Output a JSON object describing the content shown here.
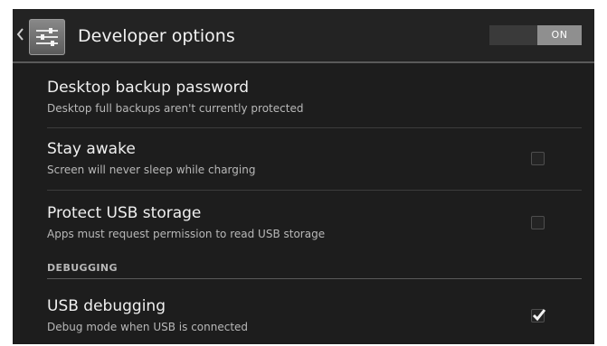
{
  "actionbar": {
    "title": "Developer options",
    "switch_label": "ON",
    "back_icon": "chevron-left-icon",
    "app_icon": "developer-settings-icon"
  },
  "preferences": [
    {
      "title": "Desktop backup password",
      "summary": "Desktop full backups aren't currently protected"
    },
    {
      "title": "Stay awake",
      "summary": "Screen will never sleep while charging",
      "checked": false
    },
    {
      "title": "Protect USB storage",
      "summary": "Apps must request permission to read USB storage",
      "checked": false
    }
  ],
  "debugging": {
    "header": "DEBUGGING",
    "items": [
      {
        "title": "USB debugging",
        "summary": "Debug mode when USB is connected",
        "checked": true
      }
    ]
  },
  "colors": {
    "background": "#1d1d1d",
    "text_primary": "#f0f0f0",
    "text_secondary": "#b8b8b8",
    "switch_on": "#8f8f8f"
  }
}
